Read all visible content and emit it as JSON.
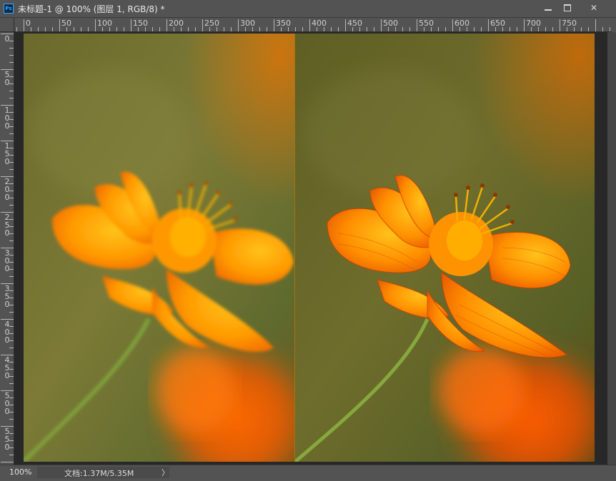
{
  "window": {
    "app_icon": "Ps",
    "title": "未标题-1 @ 100% (图层 1, RGB/8) *",
    "minimize_icon": "minimize-icon",
    "maximize_icon": "maximize-icon",
    "close_icon": "✕"
  },
  "ruler_h": [
    "0",
    "50",
    "100",
    "150",
    "200",
    "250",
    "300",
    "350",
    "400",
    "450",
    "500",
    "550",
    "600",
    "650",
    "700",
    "750"
  ],
  "ruler_v": [
    "0",
    "50",
    "100",
    "150",
    "200",
    "250",
    "300",
    "350",
    "400",
    "450",
    "500",
    "550"
  ],
  "canvas": {
    "layers": [
      "blurred-original",
      "sharpened-result"
    ],
    "colors": {
      "background": "#5e6a2a",
      "petal": "#ff9a00",
      "petal_dark": "#e85a00",
      "stem": "#7fa03a"
    }
  },
  "status": {
    "zoom": "100%",
    "doc_info": "文档:1.37M/5.35M",
    "arrow": "〉"
  }
}
